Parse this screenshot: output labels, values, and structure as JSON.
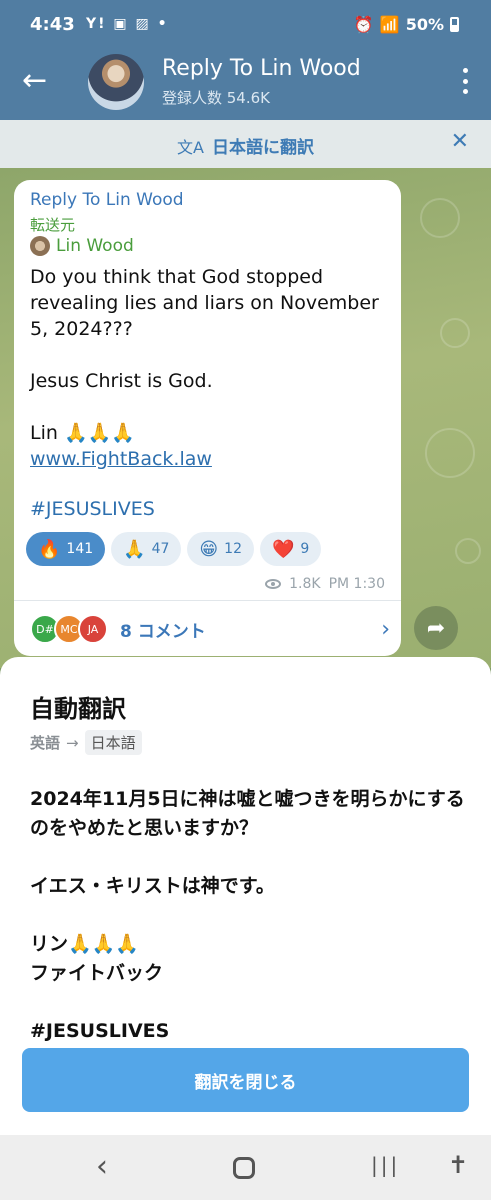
{
  "status_bar": {
    "time": "4:43",
    "left_icons": "Y! ▣ ▨ •",
    "battery": "50%"
  },
  "header": {
    "back_icon": "arrow-back-icon",
    "title": "Reply To Lin Wood",
    "subtitle": "登録人数 54.6K"
  },
  "translate_bar": {
    "icon": "文A",
    "label": "日本語に翻訳",
    "close": "✕"
  },
  "message": {
    "channel_name": "Reply To Lin Wood",
    "forwarded_label": "転送元",
    "author": "Lin Wood",
    "text_line1": "Do you think that God stopped revealing lies and liars on November 5, 2024???",
    "text_line2": "Jesus Christ is God.",
    "text_line3": "Lin 🙏🙏🙏",
    "link": "www.FightBack.law",
    "hashtag": "#JESUSLIVES",
    "reactions": [
      {
        "emoji": "🔥",
        "count": "141"
      },
      {
        "emoji": "🙏",
        "count": "47"
      },
      {
        "emoji": "😁",
        "count": "12"
      },
      {
        "emoji": "❤️",
        "count": "9"
      }
    ],
    "views": "1.8K",
    "time": "PM 1:30",
    "comment_avatars": [
      {
        "initials": "D#",
        "color": "#3aa84a"
      },
      {
        "initials": "MC",
        "color": "#e8862e"
      },
      {
        "initials": "JA",
        "color": "#d9433b"
      }
    ],
    "comments_label": "8 コメント"
  },
  "sheet": {
    "title": "自動翻訳",
    "from_lang": "英語",
    "arrow": "→",
    "to_lang": "日本語",
    "para1": "2024年11月5日に神は嘘と嘘つきを明らかにするのをやめたと思いますか？",
    "para2": "イエス・キリストは神です。",
    "para3_line1": "リン🙏🙏🙏",
    "para3_line2": "ファイトバック",
    "para4": "#JESUSLIVES",
    "close_button": "翻訳を閉じる"
  },
  "nav_bar": {
    "back": "‹",
    "recents": "|||",
    "accessibility": "✝"
  },
  "colors": {
    "header": "#517da2",
    "accent_blue": "#3b77b8",
    "green_name": "#4a9d3c",
    "button": "#54a6e8"
  }
}
